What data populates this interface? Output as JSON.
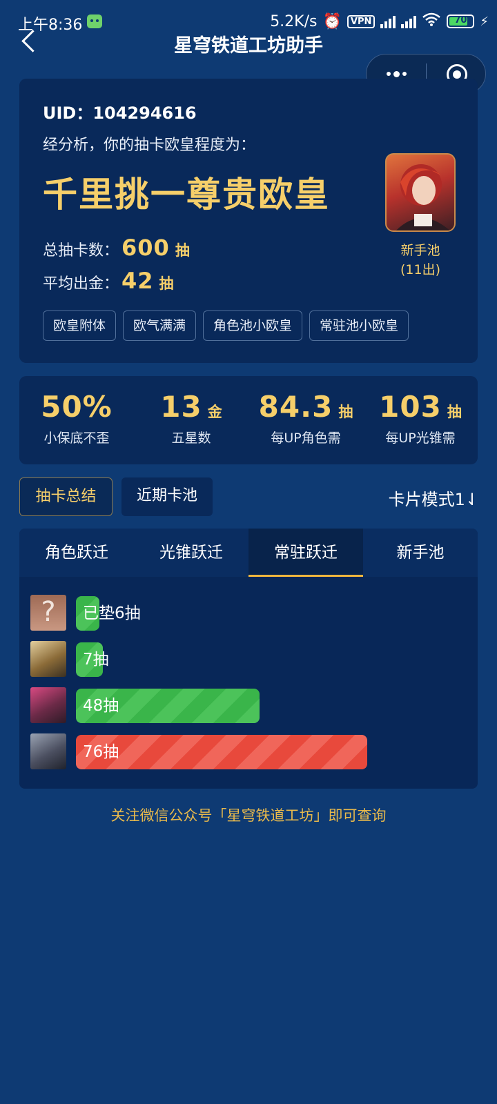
{
  "status_bar": {
    "time": "上午8:36",
    "net_speed": "5.2K/s",
    "vpn": "VPN",
    "battery": "70",
    "icons": [
      "android-icon",
      "alarm-icon",
      "vpn-icon",
      "signal-icon",
      "signal-icon",
      "wifi-icon",
      "battery-icon",
      "charging-icon"
    ]
  },
  "nav": {
    "title": "星穹铁道工坊助手"
  },
  "summary": {
    "uid": "UID：104294616",
    "analysis": "经分析，你的抽卡欧皇程度为：",
    "rank": "千里挑一尊贵欧皇",
    "total_label": "总抽卡数：",
    "total_value": "600",
    "avg_label": "平均出金：",
    "avg_value": "42",
    "unit": "抽",
    "pool_name": "新手池",
    "pool_count": "(11出)",
    "tags": [
      "欧皇附体",
      "欧气满满",
      "角色池小欧皇",
      "常驻池小欧皇"
    ]
  },
  "stats": [
    {
      "value": "50%",
      "unit": "",
      "label": "小保底不歪"
    },
    {
      "value": "13",
      "unit": "金",
      "label": "五星数"
    },
    {
      "value": "84.3",
      "unit": "抽",
      "label": "每UP角色需"
    },
    {
      "value": "103",
      "unit": "抽",
      "label": "每UP光锥需"
    }
  ],
  "mode_buttons": {
    "summary": "抽卡总结",
    "recent": "近期卡池",
    "card_mode": "卡片模式1⇃"
  },
  "pool_tabs": [
    "角色跃迁",
    "光锥跃迁",
    "常驻跃迁",
    "新手池"
  ],
  "active_tab_index": 2,
  "pulls": [
    {
      "label": "已垫6抽",
      "count": 6,
      "color": "green",
      "thumb": "unknown"
    },
    {
      "label": "7抽",
      "count": 7,
      "color": "green",
      "thumb": "character"
    },
    {
      "label": "48抽",
      "count": 48,
      "color": "green",
      "thumb": "character"
    },
    {
      "label": "76抽",
      "count": 76,
      "color": "red",
      "thumb": "character"
    }
  ],
  "footer": "关注微信公众号「星穹铁道工坊」即可查询",
  "colors": {
    "background": "#0e3a73",
    "card": "#09295a",
    "gold": "#f6cf6a",
    "green": "#3ab54a",
    "red": "#e8493c",
    "tab_underline": "#f0b73d"
  }
}
